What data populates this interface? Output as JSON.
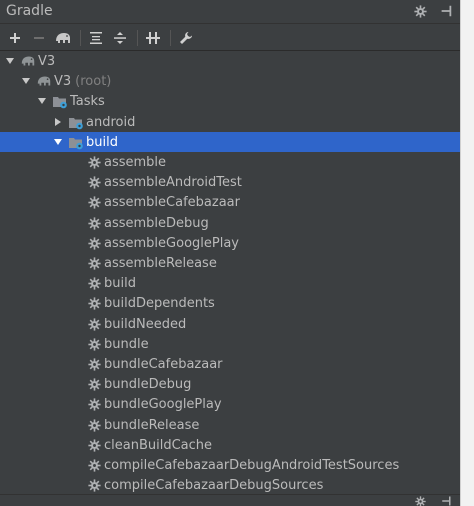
{
  "panel": {
    "title": "Gradle"
  },
  "tree": {
    "rows": [
      {
        "label": "V3",
        "suffix": "",
        "icon": "gradle-elephant-icon",
        "arrow": "down"
      },
      {
        "label": "V3",
        "suffix": "(root)",
        "icon": "gradle-elephant-icon",
        "arrow": "down"
      },
      {
        "label": "Tasks",
        "suffix": "",
        "icon": "folder-gear-icon",
        "arrow": "down"
      },
      {
        "label": "android",
        "suffix": "",
        "icon": "folder-gear-icon",
        "arrow": "right"
      },
      {
        "label": "build",
        "suffix": "",
        "icon": "folder-gear-icon",
        "arrow": "down",
        "selected": true
      },
      {
        "label": "assemble",
        "icon": "gear-icon"
      },
      {
        "label": "assembleAndroidTest",
        "icon": "gear-icon"
      },
      {
        "label": "assembleCafebazaar",
        "icon": "gear-icon"
      },
      {
        "label": "assembleDebug",
        "icon": "gear-icon"
      },
      {
        "label": "assembleGooglePlay",
        "icon": "gear-icon"
      },
      {
        "label": "assembleRelease",
        "icon": "gear-icon"
      },
      {
        "label": "build",
        "icon": "gear-icon"
      },
      {
        "label": "buildDependents",
        "icon": "gear-icon"
      },
      {
        "label": "buildNeeded",
        "icon": "gear-icon"
      },
      {
        "label": "bundle",
        "icon": "gear-icon"
      },
      {
        "label": "bundleCafebazaar",
        "icon": "gear-icon"
      },
      {
        "label": "bundleDebug",
        "icon": "gear-icon"
      },
      {
        "label": "bundleGooglePlay",
        "icon": "gear-icon"
      },
      {
        "label": "bundleRelease",
        "icon": "gear-icon"
      },
      {
        "label": "cleanBuildCache",
        "icon": "gear-icon"
      },
      {
        "label": "compileCafebazaarDebugAndroidTestSources",
        "icon": "gear-icon"
      },
      {
        "label": "compileCafebazaarDebugSources",
        "icon": "gear-icon"
      }
    ]
  },
  "colors": {
    "background": "#3c3f41",
    "selection": "#2f65ca",
    "text": "#bbbbbb",
    "muted": "#808080",
    "icon": "#afb1b3",
    "folder_badge": "#3d9fd8"
  }
}
